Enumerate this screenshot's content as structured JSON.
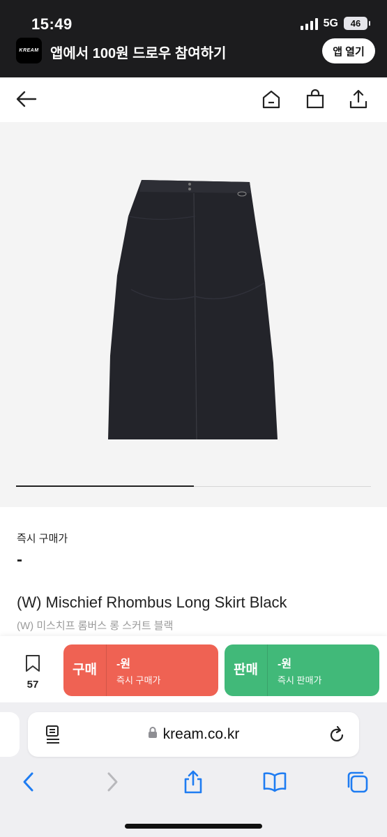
{
  "status_bar": {
    "time": "15:49",
    "network": "5G",
    "battery": "46"
  },
  "banner": {
    "logo_text": "KREAM",
    "text": "앱에서 100원 드로우 참여하기",
    "button_label": "앱 열기"
  },
  "nav": {
    "icons": [
      "back-arrow-icon",
      "home-icon",
      "shopping-bag-icon",
      "share-icon"
    ]
  },
  "product": {
    "image_icon": "black-long-skirt",
    "gallery_progress": 0.5,
    "price_label": "즉시 구매가",
    "price_value": "-",
    "name_en": "(W) Mischief Rhombus Long Skirt Black",
    "name_ko": "(W) 미스치프 롬버스 롱 스커트 블랙"
  },
  "actions": {
    "wish_count": "57",
    "buy": {
      "label": "구매",
      "price": "-원",
      "sub": "즉시 구매가",
      "color": "#ef6253"
    },
    "sell": {
      "label": "판매",
      "price": "-원",
      "sub": "즉시 판매가",
      "color": "#41b979"
    }
  },
  "browser": {
    "url": "kream.co.kr",
    "icons": [
      "reader-icon",
      "lock-icon",
      "reload-icon",
      "back-icon",
      "forward-icon",
      "share-icon",
      "bookmarks-icon",
      "tabs-icon"
    ]
  }
}
